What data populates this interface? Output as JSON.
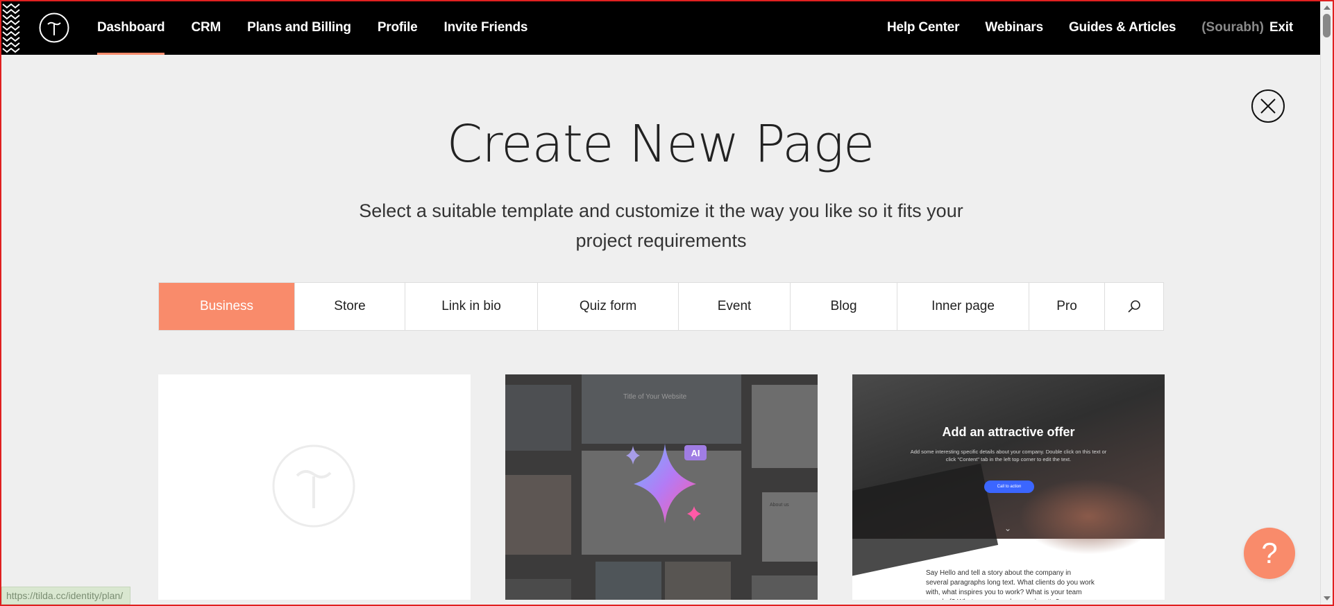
{
  "nav": {
    "left": [
      {
        "label": "Dashboard",
        "active": true
      },
      {
        "label": "CRM"
      },
      {
        "label": "Plans and Billing"
      },
      {
        "label": "Profile"
      },
      {
        "label": "Invite Friends"
      }
    ],
    "right": [
      {
        "label": "Help Center"
      },
      {
        "label": "Webinars"
      },
      {
        "label": "Guides & Articles"
      }
    ],
    "user": "(Sourabh)",
    "exit": "Exit"
  },
  "page": {
    "title": "Create New Page",
    "subtitle": "Select a suitable template and customize it the way you like so it fits your project requirements"
  },
  "tabs": [
    {
      "label": "Business",
      "active": true
    },
    {
      "label": "Store"
    },
    {
      "label": "Link in bio"
    },
    {
      "label": "Quiz form"
    },
    {
      "label": "Event"
    },
    {
      "label": "Blog"
    },
    {
      "label": "Inner page"
    },
    {
      "label": "Pro"
    }
  ],
  "cards": {
    "ai": {
      "badge": "AI",
      "preview_title": "Title of Your Website",
      "about": "About us"
    },
    "offer": {
      "title": "Add an attractive offer",
      "text": "Add some interesting specific details about your company. Double click on this text or click \"Content\" tab in the left top corner to edit the text.",
      "cta": "Call to action",
      "story": "Say Hello and tell a story about the company in several paragraphs long text. What clients do you work with, what inspires you to work? What is your team proud of? What are your values and motto?"
    }
  },
  "help_label": "?",
  "status_url": "https://tilda.cc/identity/plan/",
  "colors": {
    "accent": "#f98b6b",
    "topbar": "#000000",
    "background": "#efefef"
  }
}
